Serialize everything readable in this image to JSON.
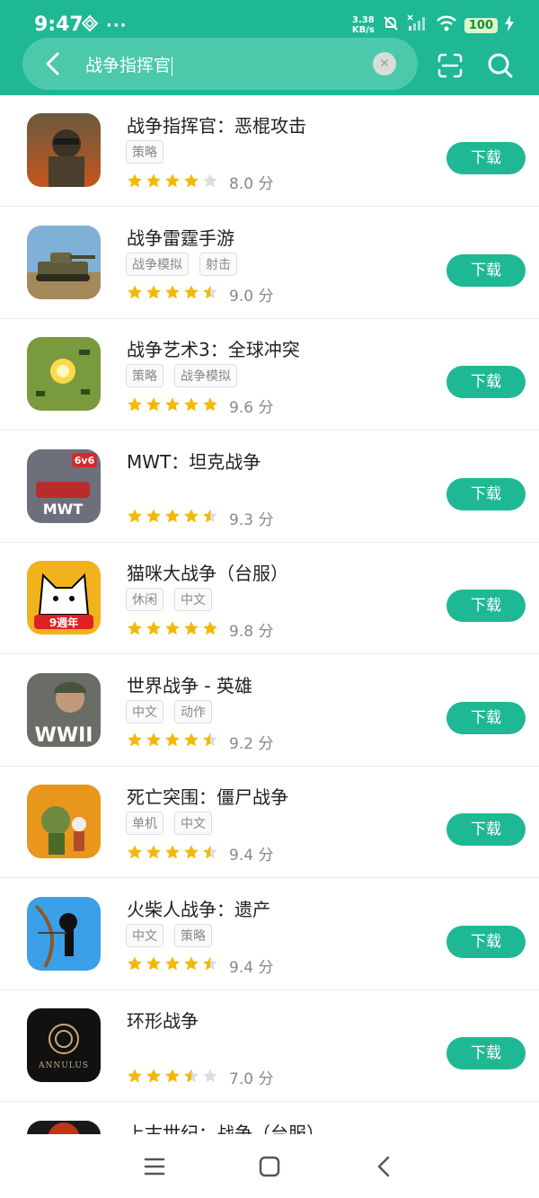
{
  "status": {
    "time": "9:47",
    "net_speed_value": "3.38",
    "net_speed_unit": "KB/s",
    "battery": "100"
  },
  "search": {
    "query": "战争指挥官"
  },
  "colors": {
    "brand": "#1fb894",
    "star": "#f5b800",
    "star_empty": "#dddddd"
  },
  "apps": [
    {
      "name": "战争指挥官：恶棍攻击",
      "tags": [
        "策略"
      ],
      "rating": 4,
      "score": "8.0 分",
      "download": "下载",
      "icon": "soldier-icon"
    },
    {
      "name": "战争雷霆手游",
      "tags": [
        "战争模拟",
        "射击"
      ],
      "rating": 4.5,
      "score": "9.0 分",
      "download": "下载",
      "icon": "tank-icon"
    },
    {
      "name": "战争艺术3：全球冲突",
      "tags": [
        "策略",
        "战争模拟"
      ],
      "rating": 5,
      "score": "9.6 分",
      "download": "下载",
      "icon": "battlefield-icon"
    },
    {
      "name": "MWT：坦克战争",
      "tags": [],
      "rating": 4.5,
      "score": "9.3 分",
      "download": "下载",
      "icon": "mwt-tank-icon"
    },
    {
      "name": "猫咪大战争（台服）",
      "tags": [
        "休闲",
        "中文"
      ],
      "rating": 5,
      "score": "9.8 分",
      "download": "下载",
      "icon": "cat-icon"
    },
    {
      "name": "世界战争 - 英雄",
      "tags": [
        "中文",
        "动作"
      ],
      "rating": 4.5,
      "score": "9.2 分",
      "download": "下载",
      "icon": "wwii-soldier-icon"
    },
    {
      "name": "死亡突围：僵尸战争",
      "tags": [
        "单机",
        "中文"
      ],
      "rating": 4.5,
      "score": "9.4 分",
      "download": "下载",
      "icon": "zombie-icon"
    },
    {
      "name": "火柴人战争：遗产",
      "tags": [
        "中文",
        "策略"
      ],
      "rating": 4.5,
      "score": "9.4 分",
      "download": "下载",
      "icon": "stickman-icon"
    },
    {
      "name": "环形战争",
      "tags": [],
      "rating": 3.5,
      "score": "7.0 分",
      "download": "下载",
      "icon": "annulus-icon"
    },
    {
      "name": "上古世纪：战争（台服）",
      "tags": [],
      "rating": 0,
      "score": "",
      "download": "",
      "icon": "archeage-icon"
    }
  ],
  "annulus_logo_text": "ANNULUS",
  "mwt_logo_text": "MWT",
  "mwt_badge": "6v6",
  "wwii_text": "WWII",
  "cat_badge": "9週年"
}
